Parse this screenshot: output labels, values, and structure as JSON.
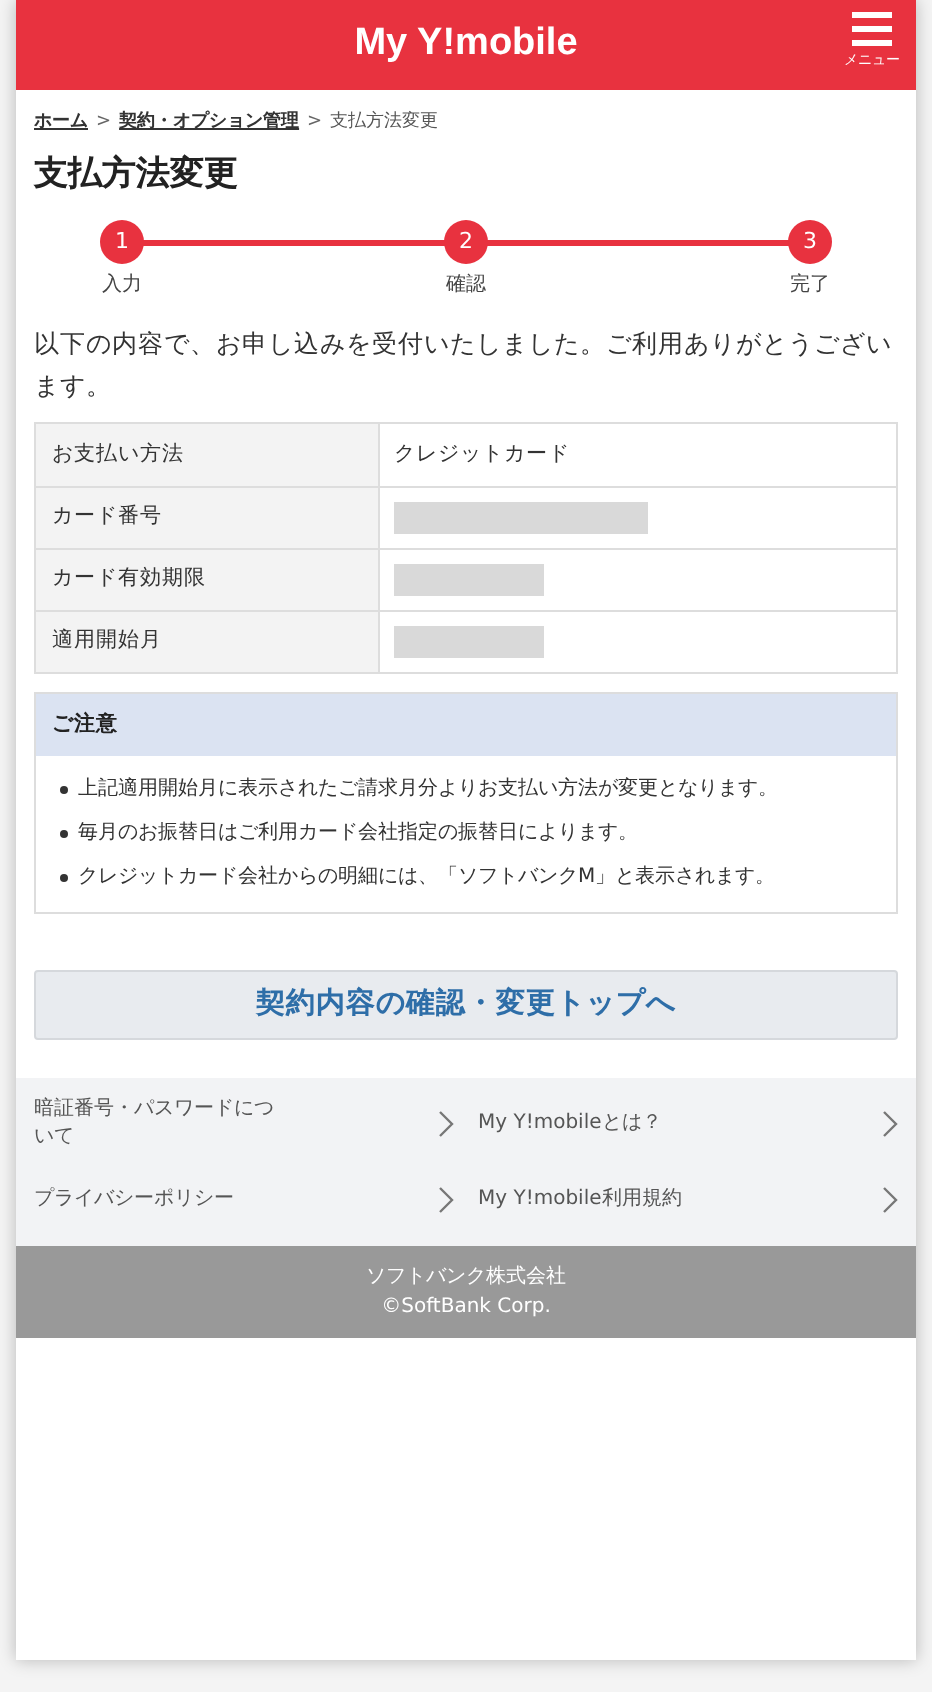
{
  "header": {
    "logo": "My Y!mobile",
    "menu_label": "メニュー"
  },
  "breadcrumb": [
    {
      "label": "ホーム",
      "link": true
    },
    {
      "label": "契約・オプション管理",
      "link": true
    },
    {
      "label": "支払方法変更",
      "link": false
    }
  ],
  "breadcrumb_separator": ">",
  "page_title": "支払方法変更",
  "steps": [
    {
      "number": "1",
      "label": "入力",
      "done": true
    },
    {
      "number": "2",
      "label": "確認",
      "done": true
    },
    {
      "number": "3",
      "label": "完了",
      "done": true
    }
  ],
  "message": "以下の内容で、お申し込みを受付いたしました。ご利用ありがとうございます。",
  "details": [
    {
      "label": "お支払い方法",
      "kind": "text",
      "value": "クレジットカード"
    },
    {
      "label": "カード番号",
      "kind": "masked"
    },
    {
      "label": "カード有効期限",
      "kind": "masked"
    },
    {
      "label": "適用開始月",
      "kind": "masked"
    }
  ],
  "notice": {
    "title": "ご注意",
    "items": [
      "上記適用開始月に表示されたご請求月分よりお支払い方法が変更となります。",
      "毎月のお振替日はご利用カード会社指定の振替日によります。",
      "クレジットカード会社からの明細には、「ソフトバンクM」と表示されます。"
    ]
  },
  "top_button": "契約内容の確認・変更トップへ",
  "footer_links": [
    "暗証番号・パスワードについて",
    "My Y!mobileとは？",
    "プライバシーポリシー",
    "My Y!mobile利用規約"
  ],
  "copyright": [
    "ソフトバンク株式会社",
    "©SoftBank Corp."
  ]
}
